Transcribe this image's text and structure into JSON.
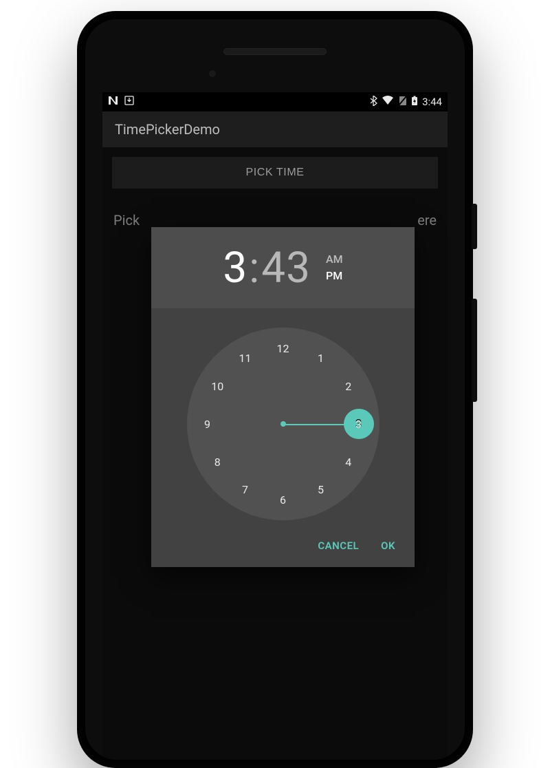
{
  "status_bar": {
    "clock": "3:44",
    "icons": {
      "n": "N",
      "download": "download-icon",
      "bluetooth": "bluetooth-icon",
      "wifi": "wifi-icon",
      "nosim": "no-sim-icon",
      "battery": "battery-charging-icon"
    }
  },
  "app": {
    "title": "TimePickerDemo"
  },
  "buttons": {
    "pick_time": "PICK TIME"
  },
  "hint": {
    "left": "Pick",
    "right": "ere"
  },
  "picker": {
    "hour": "3",
    "colon": ":",
    "minute": "43",
    "am_label": "AM",
    "pm_label": "PM",
    "period": "PM",
    "selected_hour": 3,
    "clock_numbers": [
      "12",
      "1",
      "2",
      "3",
      "4",
      "5",
      "6",
      "7",
      "8",
      "9",
      "10",
      "11"
    ]
  },
  "dialog_actions": {
    "cancel": "CANCEL",
    "ok": "OK"
  },
  "colors": {
    "accent": "#5bc9ba",
    "surface": "#424242"
  }
}
